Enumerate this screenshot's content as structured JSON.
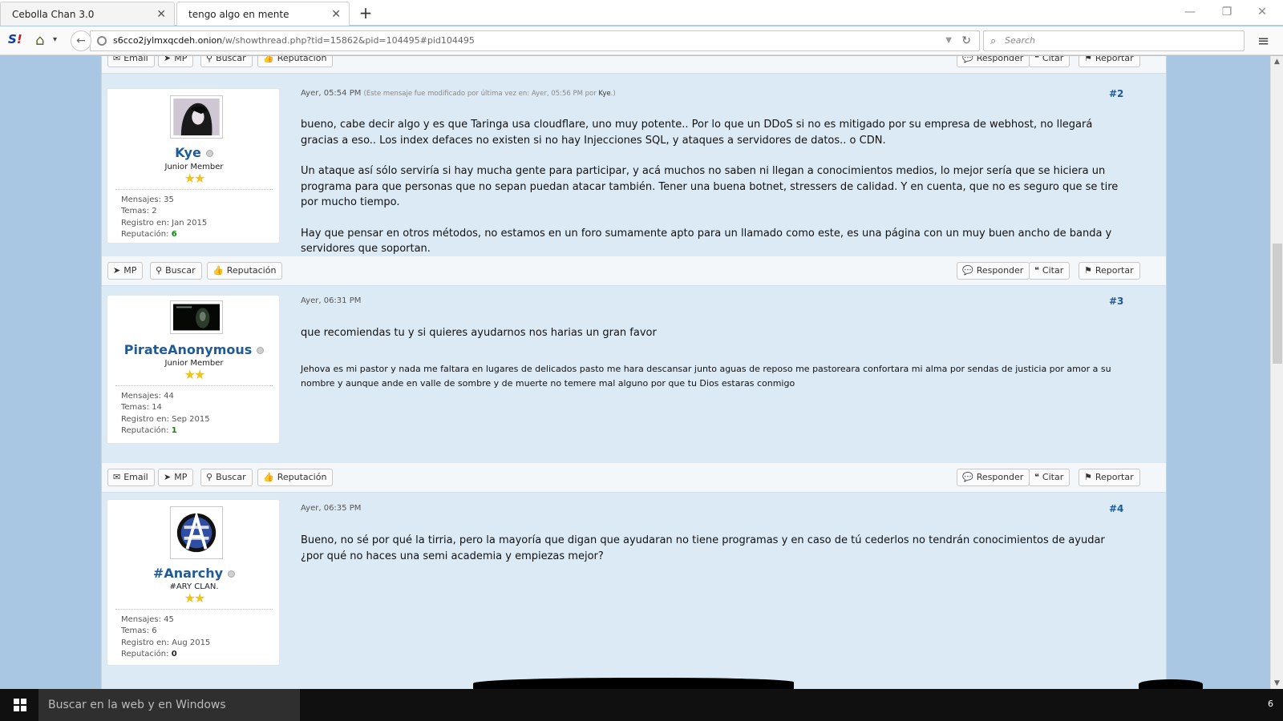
{
  "browser": {
    "tabs": [
      {
        "title": "Cebolla Chan 3.0",
        "close": "✕"
      },
      {
        "title": "tengo algo en mente",
        "close": "✕"
      }
    ],
    "new_tab": "+",
    "window_controls": {
      "minimize": "—",
      "restore": "❐",
      "close": "✕"
    },
    "url_host": "s6cco2jylmxqcdeh.onion",
    "url_path": "/w/showthread.php?tid=15862&pid=104495#pid104495",
    "search_placeholder": "Search"
  },
  "top_buttons": {
    "left": [
      "Email",
      "MP",
      "Buscar",
      "Reputación"
    ],
    "right": [
      "Responder",
      "Citar",
      "Reportar"
    ]
  },
  "posts": [
    {
      "number": "#2",
      "date": "Ayer, 05:54 PM",
      "edit_note_prefix": "(Este mensaje fue modificado por última vez en: Ayer, 05:56 PM por ",
      "edit_note_user": "Kye",
      "edit_note_suffix": ".)",
      "user": {
        "name": "Kye",
        "role": "Junior Member",
        "stars": "★★",
        "mensajes": "Mensajes: 35",
        "temas": "Temas: 2",
        "registro": "Registro en: Jan 2015",
        "reputacion_label": "Reputación:",
        "reputacion_value": "6"
      },
      "paragraphs": [
        "bueno, cabe decir algo y es que Taringa usa cloudflare, uno muy potente.. Por lo que un DDoS si no es mitigado por su empresa de webhost, no llegará gracias a eso.. Los index defaces no existen si no hay Injecciones SQL, y ataques a servidores de datos.. o CDN.",
        "Un ataque así sólo serviría si hay mucha gente para participar, y acá muchos no saben ni llegan a conocimientos medios, lo mejor sería que se hiciera un programa para que personas que no sepan puedan atacar también. Tener una buena botnet, stressers de calidad. Y en cuenta, que no es seguro que se tire por mucho tiempo.",
        "Hay que pensar en otros métodos, no estamos en un foro sumamente apto para un llamado como este, es una página con un muy buen ancho de banda y servidores que soportan."
      ]
    },
    {
      "number": "#3",
      "date": "Ayer, 06:31 PM",
      "user": {
        "name": "PirateAnonymous",
        "role": "Junior Member",
        "stars": "★★",
        "mensajes": "Mensajes: 44",
        "temas": "Temas: 14",
        "registro": "Registro en: Sep 2015",
        "reputacion_label": "Reputación:",
        "reputacion_value": "1"
      },
      "paragraphs": [
        "que recomiendas tu y si quieres ayudarnos nos harias un gran favor"
      ],
      "signature": "Jehova es mi pastor y nada me faltara en lugares de delicados pasto me hara descansar junto aguas de reposo me pastoreara confortara mi alma por sendas de justicia por amor a su nombre y aunque ande en valle de sombre y de muerte no temere mal alguno por que tu Dios estaras conmigo"
    },
    {
      "number": "#4",
      "date": "Ayer, 06:35 PM",
      "user": {
        "name": "#Anarchy",
        "role": "#ARY CLAN.",
        "stars": "★★",
        "mensajes": "Mensajes: 45",
        "temas": "Temas: 6",
        "registro": "Registro en: Aug 2015",
        "reputacion_label": "Reputación:",
        "reputacion_value": "0"
      },
      "paragraphs": [
        "Bueno, no sé por qué la tirria, pero la mayoría que digan que ayudaran no tiene programas y en caso de tú cederlos no tendrán conocimientos de ayudar ¿por qué no haces una semi academia y empiezas mejor?"
      ]
    }
  ],
  "post2_buttons": {
    "left": [
      "MP",
      "Buscar",
      "Reputación"
    ],
    "right": [
      "Responder",
      "Citar",
      "Reportar"
    ]
  },
  "post3_buttons": {
    "left": [
      "Email",
      "MP",
      "Buscar",
      "Reputación"
    ],
    "right": [
      "Responder",
      "Citar",
      "Reportar"
    ]
  },
  "taskbar": {
    "search_placeholder": "Buscar en la web y en Windows",
    "tray_number": "6"
  },
  "colors": {
    "page_bg": "#a9c6e3",
    "post_bg": "#dceaf6",
    "username": "#1f5b96",
    "star": "#f0c21c",
    "reputation_positive": "#0a8a0a"
  }
}
